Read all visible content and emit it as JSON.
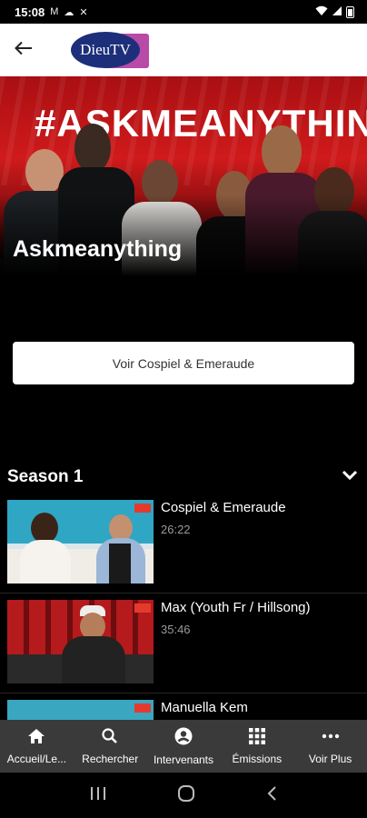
{
  "status_bar": {
    "time": "15:08",
    "icons": [
      "gmail-icon",
      "cloud-icon",
      "tools-icon",
      "wifi-icon",
      "signal-icon",
      "battery-icon"
    ]
  },
  "app_bar": {
    "back_icon": "arrow-left-icon",
    "logo_text": "DieuTV",
    "logo_colors": {
      "oval": "#1d2f7a",
      "accent": "#b84aa8"
    }
  },
  "hero": {
    "banner_text": "#ASKMEANYTHING",
    "show_title": "Askmeanything",
    "banner_color": "#d01a1b"
  },
  "play_button": {
    "label": "Voir Cospiel & Emeraude"
  },
  "season": {
    "label": "Season 1",
    "chevron_icon": "chevron-down-icon"
  },
  "episodes": [
    {
      "title": "Cospiel & Emeraude",
      "duration": "26:22"
    },
    {
      "title": "Max (Youth Fr / Hillsong)",
      "duration": "35:46"
    },
    {
      "title": "Manuella Kem",
      "duration": ""
    }
  ],
  "bottom_nav": [
    {
      "label": "Accueil/Le...",
      "icon": "home-icon"
    },
    {
      "label": "Rechercher",
      "icon": "search-icon"
    },
    {
      "label": "Intervenants",
      "icon": "account-circle-icon"
    },
    {
      "label": "Émissions",
      "icon": "grid-icon"
    },
    {
      "label": "Voir Plus",
      "icon": "more-horizontal-icon"
    }
  ],
  "system_nav": [
    "recents-icon",
    "home-circle-icon",
    "back-chevron-icon"
  ]
}
